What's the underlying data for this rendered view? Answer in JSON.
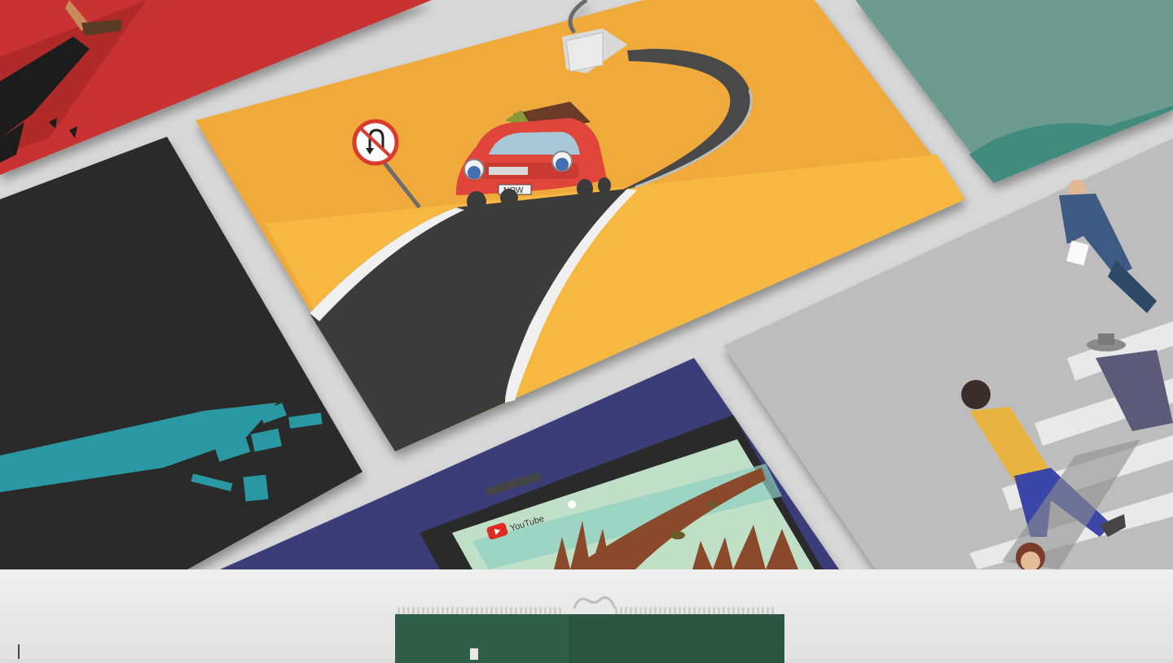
{
  "scene": {
    "description_free": true,
    "road_sign_icon": "no-u-turn-icon",
    "license_plate_text": "NOW",
    "video_brand_text": "YouTube"
  },
  "colors": {
    "background": "#d8d8d8",
    "red_card": "#c83332",
    "orange_card": "#f0a93a",
    "yellow_field": "#f6b841",
    "teal_card": "#6e9b8f",
    "dark_card": "#2b2b2b",
    "navy_card": "#3a3d78",
    "gray_card": "#bdbdbd",
    "calendar_green": "#2d5a45",
    "puzzle_teal": "#2a98a3",
    "car_red": "#e0443a"
  }
}
